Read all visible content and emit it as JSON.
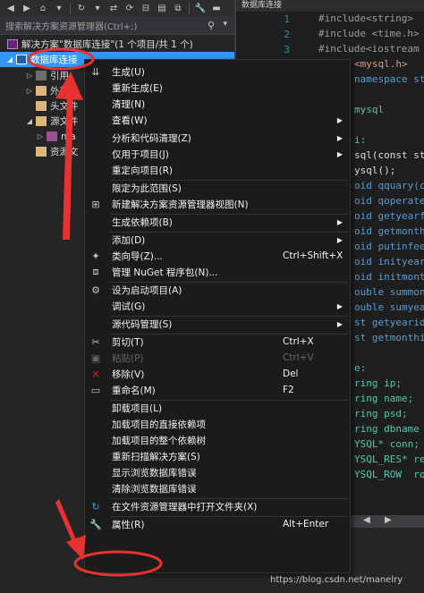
{
  "explorer": {
    "search_placeholder": "搜索解决方案资源管理器(Ctrl+;)",
    "solution_label": "解决方案\"数据库连接\"(1 个项目/共 1 个)",
    "project_label": "数据库连接",
    "children": [
      "引用",
      "外部依",
      "头文件",
      "源文件",
      "ma",
      "资源文"
    ]
  },
  "editor": {
    "tab_label": "数据库连接",
    "line_numbers": [
      "1",
      "2",
      "3"
    ],
    "code_lines": [
      "#include<string>",
      "#include <time.h>",
      "#include<iostream",
      "<mysql.h>",
      "namespace st",
      "",
      "mysql",
      "",
      "i:",
      "sql(const str",
      "ysql();",
      "oid qquary(co",
      "oid qoperate",
      "oid getyearfe",
      "oid getmonthi",
      "oid putinfee",
      "oid inityear",
      "oid initmontl",
      "ouble summon",
      "ouble sumyear",
      "st getyearid",
      "st getmonthi",
      "",
      "e:",
      "ring ip;",
      "ring name;",
      "ring psd;",
      "ring dbname",
      "YSQL* conn;",
      "YSQL_RES* re",
      "YSQL_ROW  row"
    ]
  },
  "menu": {
    "items": [
      {
        "icon": "build-icon",
        "label": "生成(U)",
        "shortcut": ""
      },
      {
        "icon": "",
        "label": "重新生成(E)",
        "shortcut": ""
      },
      {
        "icon": "",
        "label": "清理(N)",
        "shortcut": ""
      },
      {
        "icon": "",
        "label": "查看(W)",
        "shortcut": "",
        "submenu": true
      },
      {
        "icon": "",
        "label": "分析和代码清理(Z)",
        "shortcut": "",
        "submenu": true
      },
      {
        "icon": "",
        "label": "仅用于项目(J)",
        "shortcut": "",
        "submenu": true
      },
      {
        "icon": "",
        "label": "重定向项目(R)",
        "shortcut": ""
      },
      {
        "icon": "",
        "label": "限定为此范围(S)",
        "shortcut": ""
      },
      {
        "icon": "new-view-icon",
        "label": "新建解决方案资源管理器视图(N)",
        "shortcut": ""
      },
      {
        "icon": "",
        "label": "生成依赖项(B)",
        "shortcut": "",
        "submenu": true
      },
      {
        "icon": "",
        "label": "添加(D)",
        "shortcut": "",
        "submenu": true
      },
      {
        "icon": "class-wizard-icon",
        "label": "类向导(Z)...",
        "shortcut": "Ctrl+Shift+X"
      },
      {
        "icon": "nuget-icon",
        "label": "管理 NuGet 程序包(N)...",
        "shortcut": ""
      },
      {
        "icon": "gear-icon",
        "label": "设为启动项目(A)",
        "shortcut": ""
      },
      {
        "icon": "",
        "label": "调试(G)",
        "shortcut": "",
        "submenu": true
      },
      {
        "icon": "",
        "label": "源代码管理(S)",
        "shortcut": "",
        "submenu": true
      },
      {
        "icon": "scissors-icon",
        "label": "剪切(T)",
        "shortcut": "Ctrl+X"
      },
      {
        "icon": "paste-icon",
        "label": "粘贴(P)",
        "shortcut": "Ctrl+V",
        "disabled": true
      },
      {
        "icon": "remove-icon",
        "label": "移除(V)",
        "shortcut": "Del"
      },
      {
        "icon": "rename-icon",
        "label": "重命名(M)",
        "shortcut": "F2"
      },
      {
        "icon": "",
        "label": "卸载项目(L)",
        "shortcut": ""
      },
      {
        "icon": "",
        "label": "加载项目的直接依赖项",
        "shortcut": ""
      },
      {
        "icon": "",
        "label": "加载项目的整个依赖树",
        "shortcut": ""
      },
      {
        "icon": "",
        "label": "重新扫描解决方案(S)",
        "shortcut": ""
      },
      {
        "icon": "",
        "label": "显示浏览数据库错误",
        "shortcut": ""
      },
      {
        "icon": "",
        "label": "清除浏览数据库错误",
        "shortcut": ""
      },
      {
        "icon": "refresh-folder-icon",
        "label": "在文件资源管理器中打开文件夹(X)",
        "shortcut": ""
      },
      {
        "icon": "wrench-icon",
        "label": "属性(R)",
        "shortcut": "Alt+Enter"
      }
    ]
  },
  "watermark": "https://blog.csdn.net/manelry",
  "colors": {
    "accent": "#3399ff",
    "annotation": "#e8322f",
    "menu_bg": "#1b1b1c"
  }
}
